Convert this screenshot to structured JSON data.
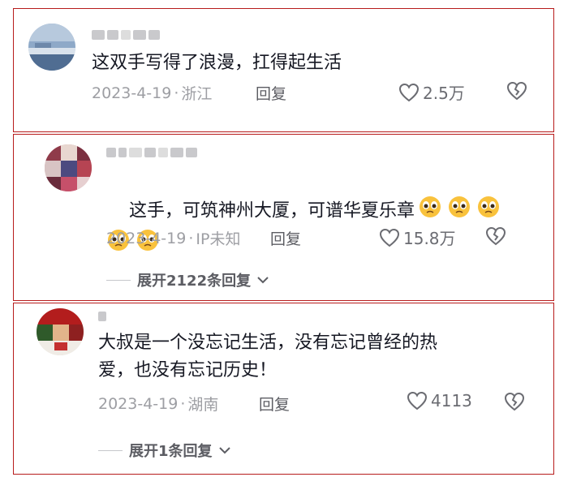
{
  "comments": [
    {
      "text": "这双手写得了浪漫，扛得起生活",
      "date": "2023-4-19",
      "sep": "·",
      "location": "浙江",
      "reply_label": "回复",
      "likes": "2.5万"
    },
    {
      "text": "这手，可筑神州大厦，可谱华夏乐章",
      "emoji": "pleading-face",
      "date": "2023-4-19",
      "sep": "·",
      "location": "IP未知",
      "reply_label": "回复",
      "likes": "15.8万",
      "expand_label": "展开2122条回复"
    },
    {
      "text": "大叔是一个没忘记生活，没有忘记曾经的热\n爱，也没有忘记历史！",
      "date": "2023-4-19",
      "sep": "·",
      "location": "湖南",
      "reply_label": "回复",
      "likes": "4113",
      "expand_label": "展开1条回复"
    }
  ],
  "icons": [
    "heart-icon",
    "broken-heart-icon",
    "chevron-down-icon",
    "pleading-face-emoji"
  ],
  "colors": {
    "border": "#b71c1c",
    "meta": "#9d9ea3",
    "text": "#161823"
  }
}
